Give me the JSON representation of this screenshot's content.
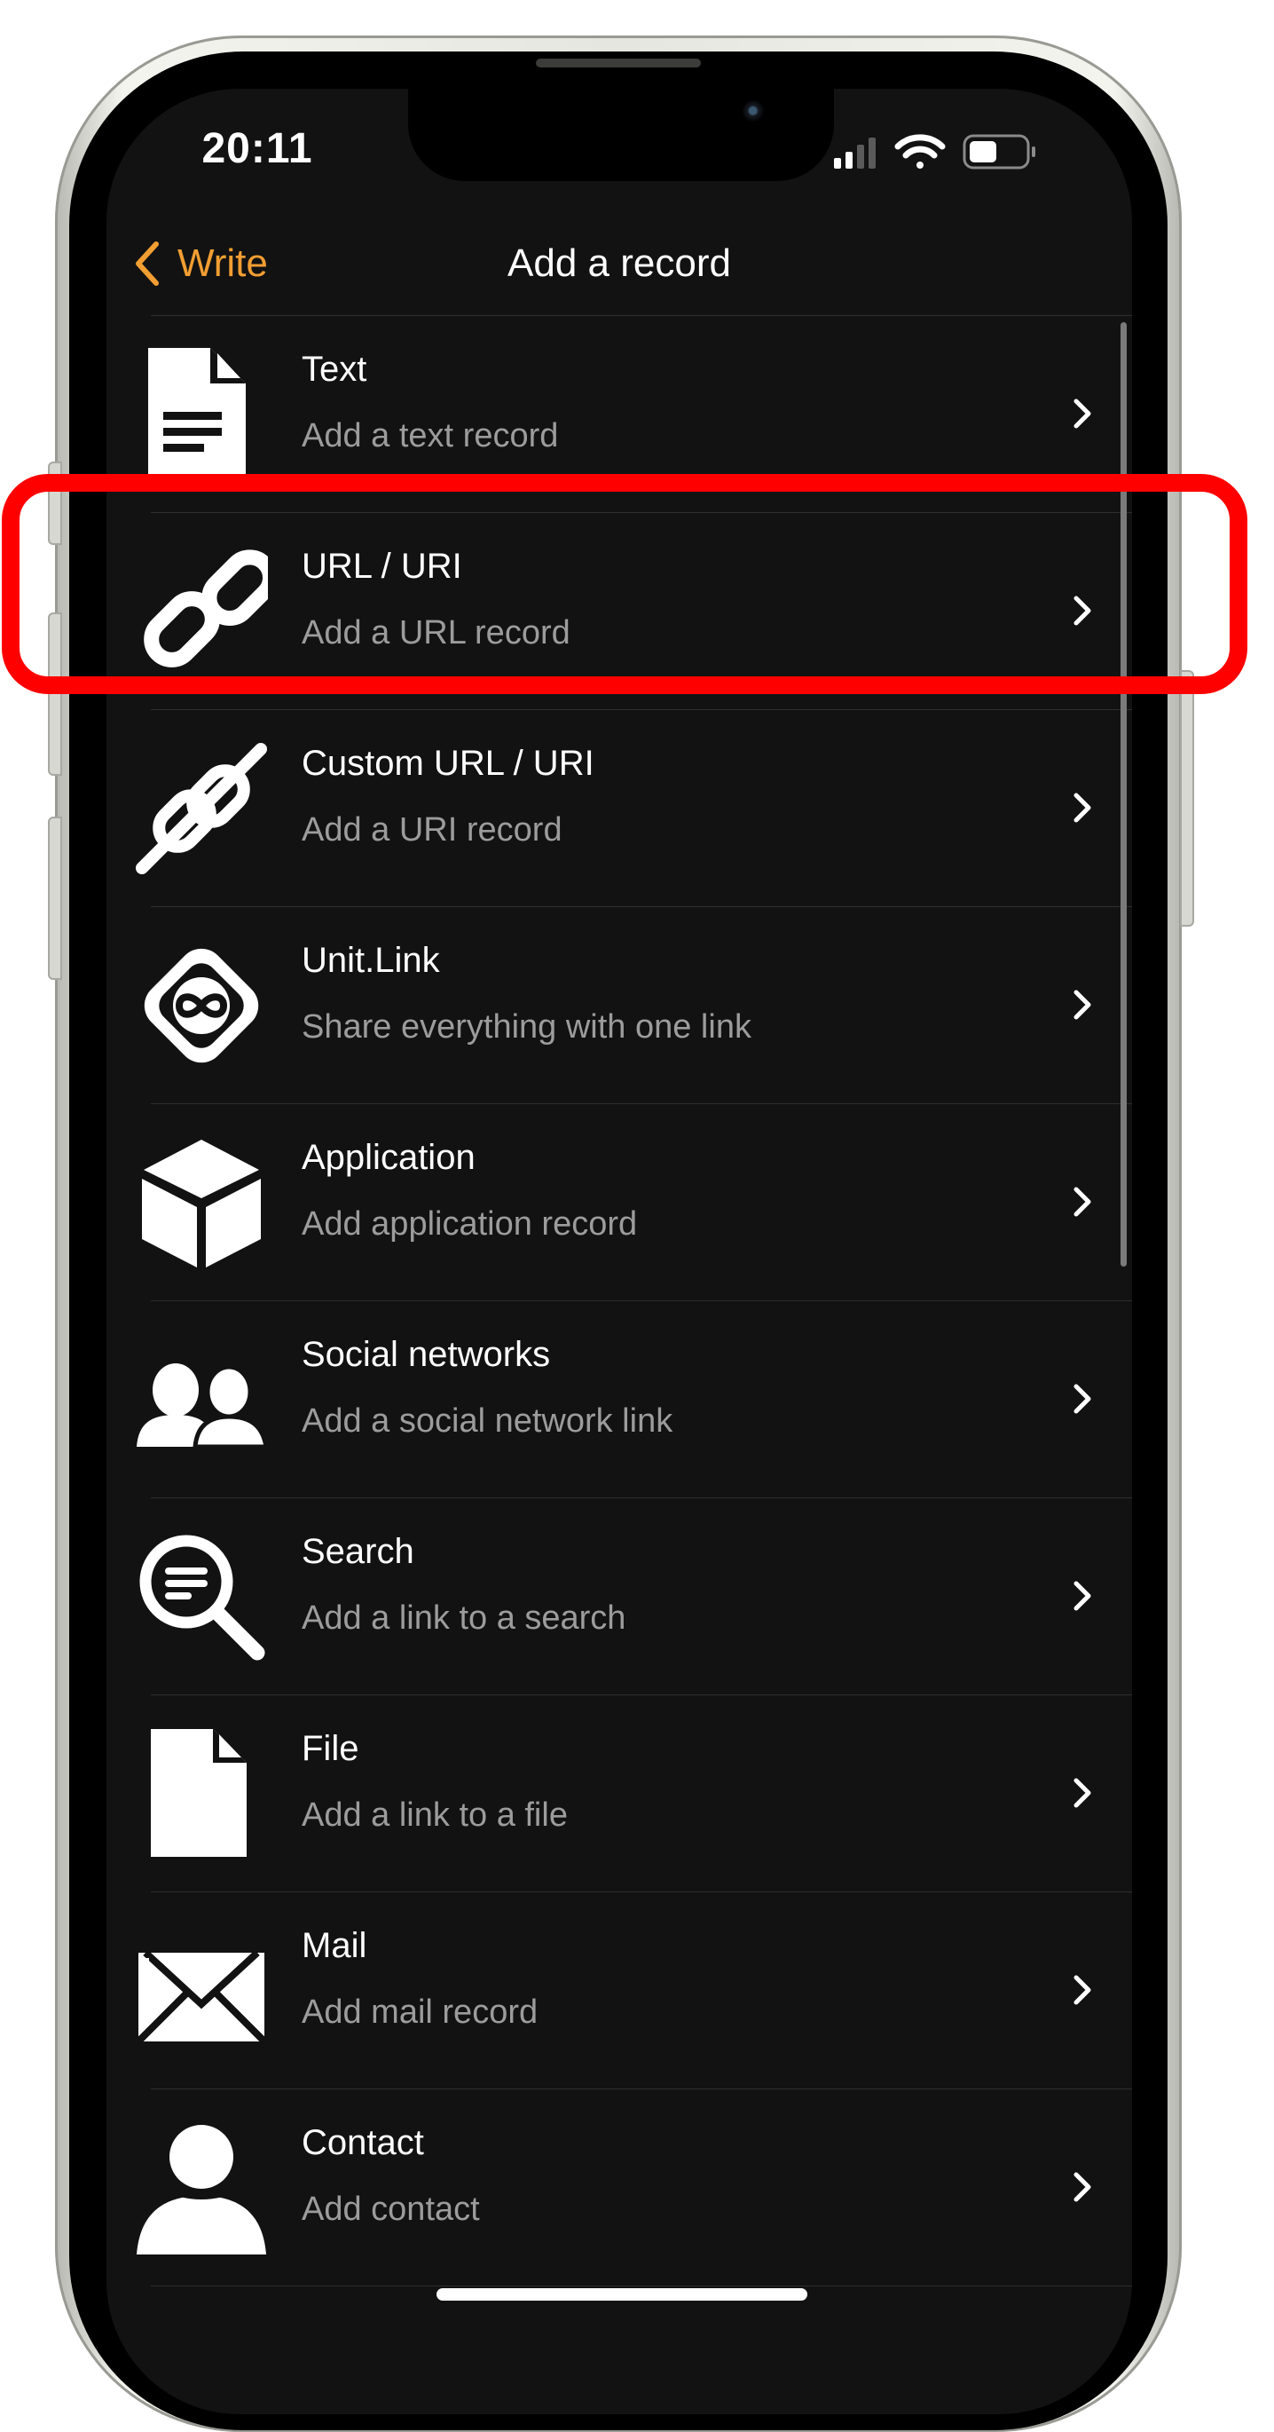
{
  "status_bar": {
    "time": "20:11"
  },
  "nav": {
    "back_label": "Write",
    "title": "Add a record"
  },
  "records": [
    {
      "title": "Text",
      "subtitle": "Add a text record",
      "icon": "document-text-icon"
    },
    {
      "title": "URL / URI",
      "subtitle": "Add a URL record",
      "icon": "link-icon"
    },
    {
      "title": "Custom URL / URI",
      "subtitle": "Add a URI record",
      "icon": "custom-link-icon"
    },
    {
      "title": "Unit.Link",
      "subtitle": "Share everything with one link",
      "icon": "infinity-diamond-icon"
    },
    {
      "title": "Application",
      "subtitle": "Add application record",
      "icon": "cube-icon"
    },
    {
      "title": "Social networks",
      "subtitle": "Add a social network link",
      "icon": "users-icon"
    },
    {
      "title": "Search",
      "subtitle": "Add a link to a search",
      "icon": "search-icon"
    },
    {
      "title": "File",
      "subtitle": "Add a link to a file",
      "icon": "file-icon"
    },
    {
      "title": "Mail",
      "subtitle": "Add mail record",
      "icon": "envelope-icon"
    },
    {
      "title": "Contact",
      "subtitle": "Add contact",
      "icon": "person-icon"
    }
  ],
  "colors": {
    "accent": "#f29e32",
    "background": "#121212",
    "highlight": "#ff0000",
    "subtitle": "#9c9c9c"
  },
  "highlighted_record": "URL / URI"
}
